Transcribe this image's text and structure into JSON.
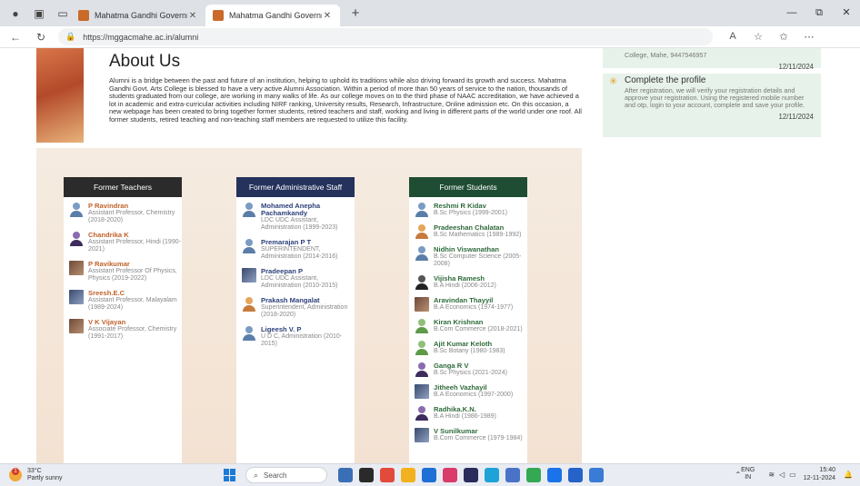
{
  "browser": {
    "tabs": [
      {
        "title": "Mahatma Gandhi Government Ar",
        "active": false
      },
      {
        "title": "Mahatma Gandhi Government Ar",
        "active": true
      }
    ],
    "url": "https://mggacmahe.ac.in/alumni"
  },
  "about": {
    "title": "About Us",
    "text": "Alumni is a bridge between the past and future of an institution, helping to uphold its traditions while also driving forward its growth and success. Mahatma Gandhi Govt. Arts College is blessed to have a very active Alumni Association. Within a period of more than 50 years of service to the nation, thousands of students graduated from our college, are working in many walks of life. As our college moves on to the third phase of NAAC accreditation, we have achieved a lot in academic and extra-curricular activities including NIRF ranking, University results, Research, Infrastructure, Online admission etc. On this occasion, a new webpage has been created to bring together former students, retired teachers and staff, working and living in different parts of the world under one roof. All former students, retired teaching and non-teaching staff members are requested to utilize this facility."
  },
  "notices": [
    {
      "text": "College, Mahe, 9447546957",
      "date": "12/11/2024"
    },
    {
      "title": "Complete the profile",
      "text": "After registration, we will verify your registration details and approve your registration. Using the registered mobile number and otp, login to your account, complete and save your profile.",
      "date": "12/11/2024"
    }
  ],
  "columns": [
    {
      "heading": "Former Teachers",
      "color": "#2b2b2b",
      "name_class": "orange",
      "people": [
        {
          "name": "P Ravindran",
          "role": "Assistant Professor, Chemistry (2018-2020)",
          "avatar": "icon-blue"
        },
        {
          "name": "Chandrika K",
          "role": "Assistant Professor, Hindi (1990-2021)",
          "avatar": "icon-purple"
        },
        {
          "name": "P Ravikumar",
          "role": "Assistant Professor Of Physics, Physics (2019-2022)",
          "avatar": "photo"
        },
        {
          "name": "Sreesh.E.C",
          "role": "Assistant Professor, Malayalam (1989-2024)",
          "avatar": "photo2"
        },
        {
          "name": "V K Vijayan",
          "role": "Associate Professor, Chemistry (1991-2017)",
          "avatar": "photo"
        }
      ]
    },
    {
      "heading": "Former Administrative Staff",
      "color": "#24325c",
      "name_class": "blue",
      "people": [
        {
          "name": "Mohamed Anepha Pachamkandy",
          "role": "LDC UDC Assistant, Administration (1999-2023)",
          "avatar": "icon-blue"
        },
        {
          "name": "Premarajan P T",
          "role": "SUPERINTENDENT, Administration (2014-2016)",
          "avatar": "icon-blue"
        },
        {
          "name": "Pradeepan P",
          "role": "LDC UDC Assistant, Administration (2010-2015)",
          "avatar": "photo2"
        },
        {
          "name": "Prakash Mangalat",
          "role": "Superintendent, Administration (2018-2020)",
          "avatar": "icon-orange"
        },
        {
          "name": "Ligeesh V. P",
          "role": "U D C, Administration (2010-2015)",
          "avatar": "icon-blue"
        }
      ]
    },
    {
      "heading": "Former Students",
      "color": "#1f4d33",
      "name_class": "green",
      "people": [
        {
          "name": "Reshmi R Kidav",
          "role": "B.Sc Physics (1999-2001)",
          "avatar": "icon-blue"
        },
        {
          "name": "Pradeeshan Chalatan",
          "role": "B.Sc Mathematics (1989-1992)",
          "avatar": "icon-orange"
        },
        {
          "name": "Nidhin Viswanathan",
          "role": "B.Sc Computer Science (2005-2008)",
          "avatar": "icon-blue"
        },
        {
          "name": "Vijisha Ramesh",
          "role": "B.A Hindi (2006-2012)",
          "avatar": "icon-dark"
        },
        {
          "name": "Aravindan Thayyil",
          "role": "B.A Economics (1974-1977)",
          "avatar": "photo"
        },
        {
          "name": "Kiran Krishnan",
          "role": "B.Com Commerce (2018-2021)",
          "avatar": "icon-green"
        },
        {
          "name": "Ajit Kumar Keloth",
          "role": "B.Sc Botany (1980-1983)",
          "avatar": "icon-green"
        },
        {
          "name": "Ganga R V",
          "role": "B.Sc Physics (2021-2024)",
          "avatar": "icon-purple"
        },
        {
          "name": "Jitheeh Vazhayil",
          "role": "B.A Economics (1997-2000)",
          "avatar": "photo2"
        },
        {
          "name": "Radhika.K.N.",
          "role": "B.A Hindi (1986-1989)",
          "avatar": "icon-purple"
        },
        {
          "name": "V Sunilkumar",
          "role": "B.Com Commerce (1979-1984)",
          "avatar": "photo2"
        }
      ]
    }
  ],
  "taskbar": {
    "temp": "33°C",
    "weather": "Partly sunny",
    "search": "Search",
    "lang1": "ENG",
    "lang2": "IN",
    "time": "15:40",
    "date": "12-11-2024"
  }
}
